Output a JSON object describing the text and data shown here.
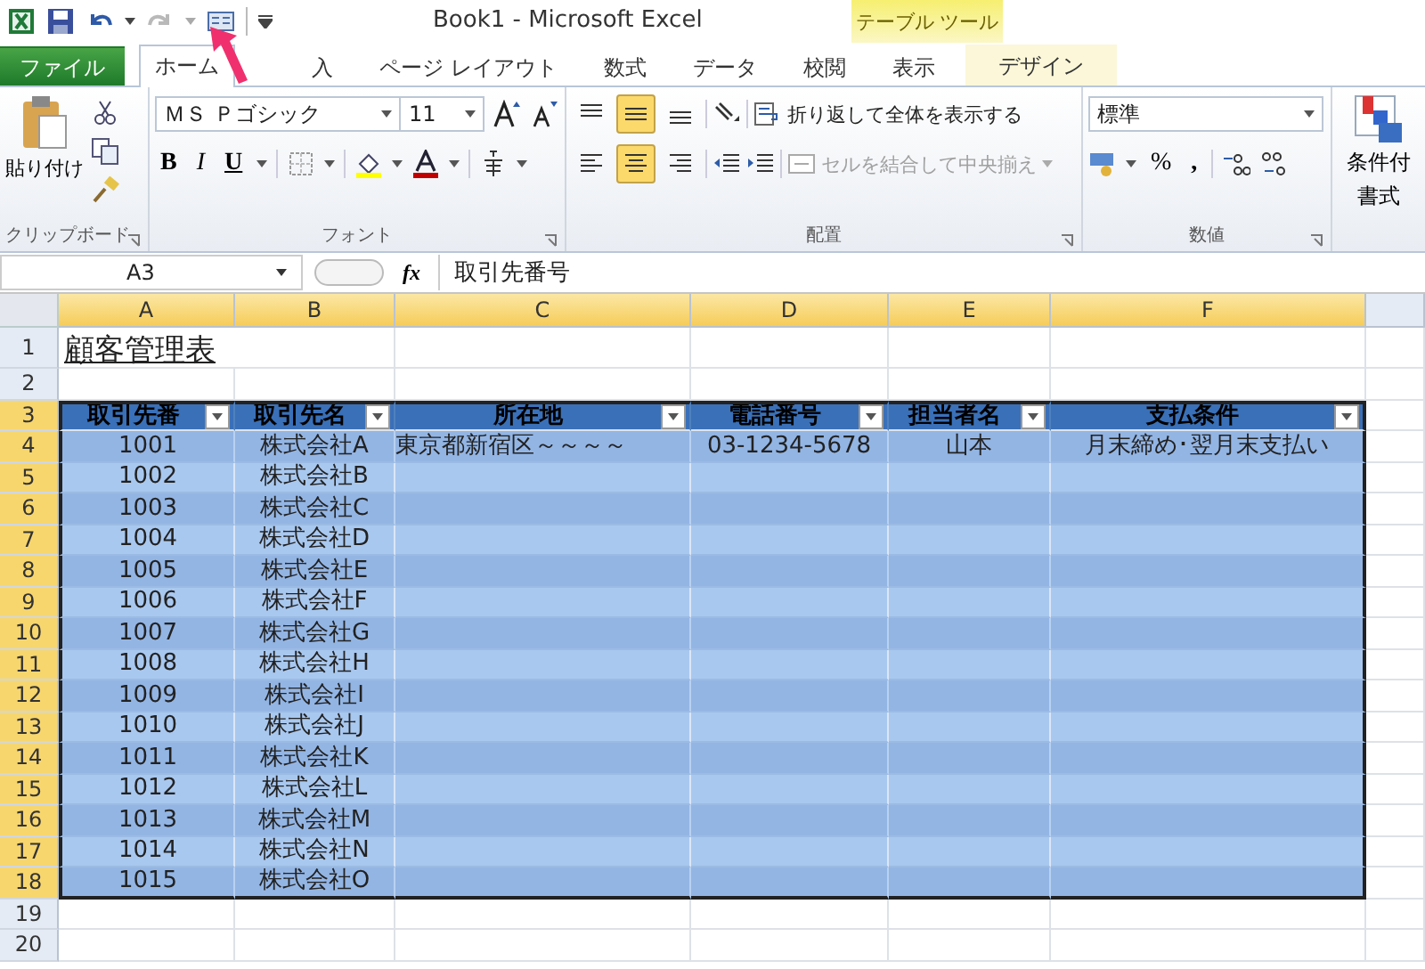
{
  "window": {
    "title": "Book1  -  Microsoft Excel",
    "context_tab_group": "テーブル ツール"
  },
  "tabs": [
    {
      "label": "ファイル",
      "kind": "file",
      "selected": false
    },
    {
      "label": "ホーム",
      "kind": "tab",
      "selected": true
    },
    {
      "label": "入",
      "kind": "tab",
      "selected": false
    },
    {
      "label": "ページ レイアウト",
      "kind": "tab",
      "selected": false
    },
    {
      "label": "数式",
      "kind": "tab",
      "selected": false
    },
    {
      "label": "データ",
      "kind": "tab",
      "selected": false
    },
    {
      "label": "校閲",
      "kind": "tab",
      "selected": false
    },
    {
      "label": "表示",
      "kind": "tab",
      "selected": false
    },
    {
      "label": "デザイン",
      "kind": "context",
      "selected": false
    }
  ],
  "ribbon": {
    "clipboard": {
      "paste": "貼り付け",
      "label": "クリップボード"
    },
    "font": {
      "name": "ＭＳ Ｐゴシック",
      "size": "11",
      "bold": "B",
      "italic": "I",
      "underline": "U",
      "label": "フォント"
    },
    "alignment": {
      "vertical": [
        {
          "selected": false
        },
        {
          "selected": true
        },
        {
          "selected": false
        }
      ],
      "horizontal": [
        {
          "selected": false
        },
        {
          "selected": true
        },
        {
          "selected": false
        }
      ],
      "wrap": {
        "label": "折り返して全体を表示する",
        "disabled": false
      },
      "merge": {
        "label": "セルを結合して中央揃え",
        "disabled": true
      },
      "label": "配置"
    },
    "number": {
      "format": "標準",
      "percent": "%",
      "comma": ",",
      "label": "数値"
    },
    "styles": {
      "conditional_line1": "条件付",
      "conditional_line2": "書式"
    }
  },
  "formula_bar": {
    "name_box": "A3",
    "fx": "fx",
    "formula": "取引先番号"
  },
  "sheet": {
    "columns": [
      {
        "label": "A",
        "selected": true
      },
      {
        "label": "B",
        "selected": true
      },
      {
        "label": "C",
        "selected": true
      },
      {
        "label": "D",
        "selected": true
      },
      {
        "label": "E",
        "selected": true
      },
      {
        "label": "F",
        "selected": true
      },
      {
        "selected": false
      }
    ],
    "rows": [
      {
        "num": "1",
        "kind": "title",
        "selected": false,
        "cells": [
          "顧客管理表"
        ]
      },
      {
        "num": "2",
        "kind": "blank",
        "selected": false,
        "cells": []
      },
      {
        "num": "3",
        "kind": "header",
        "selected": true,
        "cells": [
          "取引先番",
          "取引先名",
          "所在地",
          "電話番号",
          "担当者名",
          "支払条件"
        ]
      },
      {
        "num": "4",
        "kind": "data",
        "selected": true,
        "cells": [
          "1001",
          "株式会社A",
          "東京都新宿区～～～～",
          "03-1234-5678",
          "山本",
          "月末締め･翌月末支払い"
        ]
      },
      {
        "num": "5",
        "kind": "data",
        "selected": true,
        "cells": [
          "1002",
          "株式会社B"
        ]
      },
      {
        "num": "6",
        "kind": "data",
        "selected": true,
        "cells": [
          "1003",
          "株式会社C"
        ]
      },
      {
        "num": "7",
        "kind": "data",
        "selected": true,
        "cells": [
          "1004",
          "株式会社D"
        ]
      },
      {
        "num": "8",
        "kind": "data",
        "selected": true,
        "cells": [
          "1005",
          "株式会社E"
        ]
      },
      {
        "num": "9",
        "kind": "data",
        "selected": true,
        "cells": [
          "1006",
          "株式会社F"
        ]
      },
      {
        "num": "10",
        "kind": "data",
        "selected": true,
        "cells": [
          "1007",
          "株式会社G"
        ]
      },
      {
        "num": "11",
        "kind": "data",
        "selected": true,
        "cells": [
          "1008",
          "株式会社H"
        ]
      },
      {
        "num": "12",
        "kind": "data",
        "selected": true,
        "cells": [
          "1009",
          "株式会社I"
        ]
      },
      {
        "num": "13",
        "kind": "data",
        "selected": true,
        "cells": [
          "1010",
          "株式会社J"
        ]
      },
      {
        "num": "14",
        "kind": "data",
        "selected": true,
        "cells": [
          "1011",
          "株式会社K"
        ]
      },
      {
        "num": "15",
        "kind": "data",
        "selected": true,
        "cells": [
          "1012",
          "株式会社L"
        ]
      },
      {
        "num": "16",
        "kind": "data",
        "selected": true,
        "cells": [
          "1013",
          "株式会社M"
        ]
      },
      {
        "num": "17",
        "kind": "data",
        "selected": true,
        "cells": [
          "1014",
          "株式会社N"
        ]
      },
      {
        "num": "18",
        "kind": "data",
        "selected": true,
        "cells": [
          "1015",
          "株式会社O"
        ]
      },
      {
        "num": "19",
        "kind": "blank",
        "selected": false,
        "cells": []
      },
      {
        "num": "20",
        "kind": "blank",
        "selected": false,
        "cells": []
      }
    ]
  }
}
